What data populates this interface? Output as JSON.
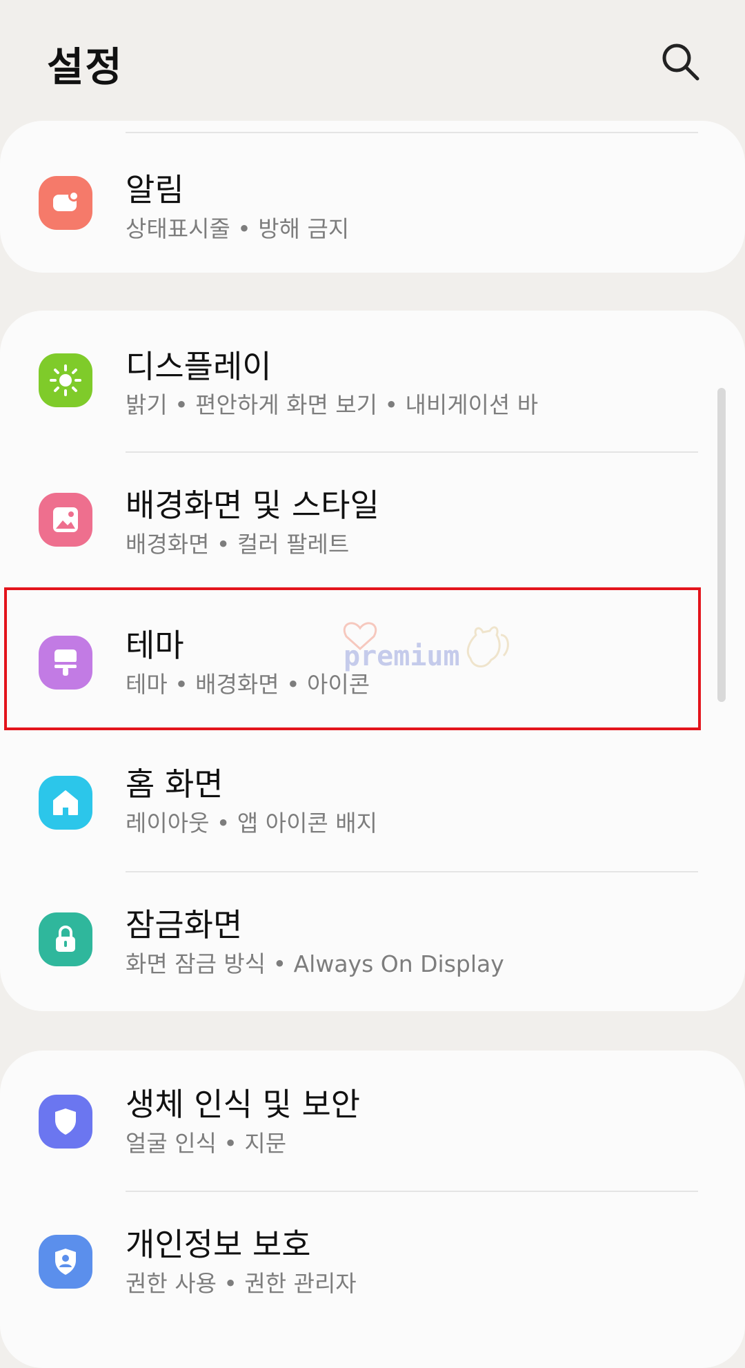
{
  "header": {
    "title": "설정",
    "search_icon": "search-icon"
  },
  "cards": [
    {
      "items": [
        {
          "title": "알림",
          "subtitle": "상태표시줄  •  방해 금지",
          "icon": "notification-icon",
          "color": "#f57a6a"
        }
      ]
    },
    {
      "items": [
        {
          "title": "디스플레이",
          "subtitle": "밝기  •  편안하게 화면 보기  •  내비게이션 바",
          "icon": "sun-icon",
          "color": "#7fcb2a"
        },
        {
          "title": "배경화면 및 스타일",
          "subtitle": "배경화면  •  컬러 팔레트",
          "icon": "image-icon",
          "color": "#ee6f8e"
        },
        {
          "title": "테마",
          "subtitle": "테마  •  배경화면  •  아이콘",
          "icon": "paint-brush-icon",
          "color": "#c27be4"
        },
        {
          "title": "홈 화면",
          "subtitle": "레이아웃  •  앱 아이콘 배지",
          "icon": "home-icon",
          "color": "#2cc6ea"
        },
        {
          "title": "잠금화면",
          "subtitle": "화면 잠금 방식  •  Always On Display",
          "icon": "lock-icon",
          "color": "#2fb79c"
        }
      ]
    },
    {
      "items": [
        {
          "title": "생체 인식 및 보안",
          "subtitle": "얼굴 인식  •  지문",
          "icon": "shield-icon",
          "color": "#6b76f0"
        },
        {
          "title": "개인정보 보호",
          "subtitle": "권한 사용  •  권한 관리자",
          "icon": "privacy-shield-icon",
          "color": "#5b8fec"
        }
      ]
    }
  ],
  "watermark": {
    "text": "premium"
  }
}
